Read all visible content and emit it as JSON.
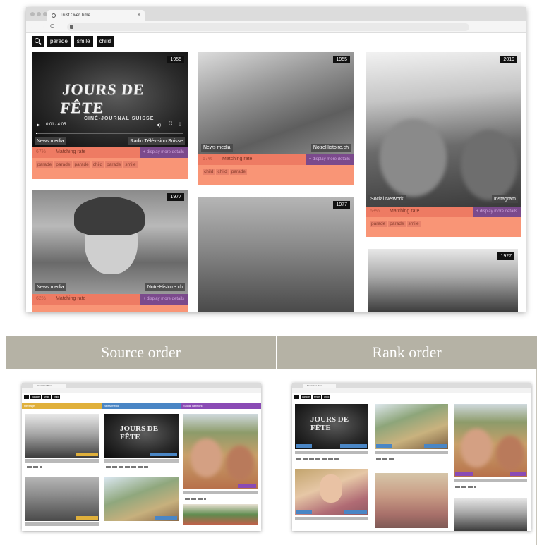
{
  "browser": {
    "tab_title": "Trust Over Time",
    "nav": {
      "back": "←",
      "forward": "→",
      "reload": "C"
    },
    "search_tags": [
      "parade",
      "smile",
      "child"
    ]
  },
  "cards": [
    {
      "year": "1955",
      "source_type": "News media",
      "source_name": "Radio Télévision Suisse",
      "match_pct": "67%",
      "match_label": "Matching rate",
      "more_label": "+ display more details",
      "tags": [
        "parade",
        "parade",
        "parade",
        "child",
        "parade",
        "smile"
      ],
      "film_title": "JOURS DE FÊTE",
      "film_subtitle": "CINÉ-JOURNAL SUISSE",
      "player_time": "0:01 / 4:05"
    },
    {
      "year": "1955",
      "source_type": "News media",
      "source_name": "NotreHistoire.ch",
      "match_pct": "67%",
      "match_label": "Matching rate",
      "more_label": "+ display more details",
      "tags": [
        "child",
        "child",
        "parade"
      ]
    },
    {
      "year": "2019",
      "source_type": "Social Network",
      "source_name": "Instagram",
      "match_pct": "63%",
      "match_label": "Matching rate",
      "more_label": "+ display more details",
      "tags": [
        "parade",
        "parade",
        "smile"
      ]
    },
    {
      "year": "1977",
      "source_type": "News media",
      "source_name": "NotreHistoire.ch",
      "match_pct": "62%",
      "match_label": "Matching rate",
      "more_label": "+ display more details"
    },
    {
      "year": "1977"
    },
    {
      "year": "1927"
    }
  ],
  "comparison": {
    "source_title": "Source order",
    "rank_title": "Rank order",
    "columns": [
      "Heritage",
      "News media",
      "Social Network"
    ],
    "colors": {
      "heritage": "#e0b03b",
      "news": "#4a86c5",
      "social": "#8a4bb5",
      "match": "#ee7b63",
      "more": "#7b4a8c"
    }
  }
}
